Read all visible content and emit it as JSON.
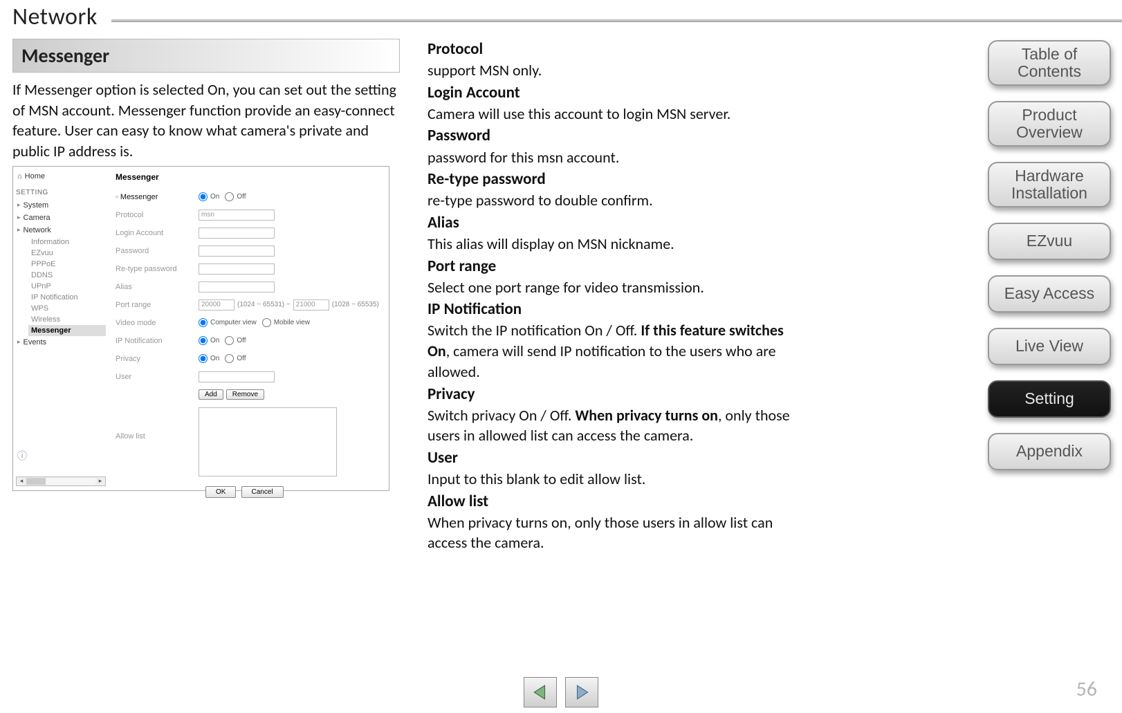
{
  "page": {
    "title": "Network",
    "number": "56"
  },
  "section": {
    "header": "Messenger",
    "intro": "If Messenger option is selected On, you can set out the setting of MSN account. Messenger function provide an easy-connect feature. User can easy to know what camera's private and public IP address is."
  },
  "screenshot": {
    "home": "Home",
    "setting_label": "SETTING",
    "tops": [
      "System",
      "Camera",
      "Network"
    ],
    "subs": [
      "Information",
      "EZvuu",
      "PPPoE",
      "DDNS",
      "UPnP",
      "IP Notification",
      "WPS",
      "Wireless"
    ],
    "sub_selected": "Messenger",
    "events": "Events",
    "form_title": "Messenger",
    "row_messenger": "Messenger",
    "on": "On",
    "off": "Off",
    "row_protocol": "Protocol",
    "protocol_value": "msn",
    "row_login": "Login Account",
    "row_pwd": "Password",
    "row_repwd": "Re-type password",
    "row_alias": "Alias",
    "row_portrange": "Port range",
    "port_lo": "20000",
    "port_lo_hint": "(1024 ~ 65531) ~",
    "port_hi": "21000",
    "port_hi_hint": "(1028 ~ 65535)",
    "row_videomode": "Video mode",
    "vm_comp": "Computer view",
    "vm_mob": "Mobile view",
    "row_ipnotif": "IP Notification",
    "row_privacy": "Privacy",
    "row_user": "User",
    "btn_add": "Add",
    "btn_remove": "Remove",
    "row_allow": "Allow list",
    "btn_ok": "OK",
    "btn_cancel": "Cancel"
  },
  "definitions": [
    {
      "term": "Protocol",
      "body": "support MSN only."
    },
    {
      "term": "Login Account",
      "body": "Camera will use this account to login MSN server."
    },
    {
      "term": "Password",
      "body": "password for this msn account."
    },
    {
      "term": "Re-type password",
      "body": "re-type password to double confirm."
    },
    {
      "term": "Alias",
      "body": "This alias will display on MSN nickname."
    },
    {
      "term": "Port range",
      "body": "Select one port range for video transmission."
    },
    {
      "term": "IP Notification",
      "body_pre": "Switch the IP notification On / Off. ",
      "bold": "If this feature switches On",
      "body_post": ", camera will send IP notification to the users who are allowed."
    },
    {
      "term": "Privacy",
      "body_pre": "Switch privacy On / Off. ",
      "bold": "When privacy turns on",
      "body_post": ", only those users in allowed list can access the camera."
    },
    {
      "term": "User",
      "body": "Input to this blank to edit allow list."
    },
    {
      "term": "Allow list",
      "body": "When privacy turns on, only those users in allow list can access the camera."
    }
  ],
  "nav": {
    "toc": "Table of Contents",
    "product": "Product Overview",
    "hardware": "Hardware Installation",
    "ezvuu": "EZvuu",
    "easy": "Easy Access",
    "live": "Live View",
    "setting": "Setting",
    "appendix": "Appendix"
  }
}
